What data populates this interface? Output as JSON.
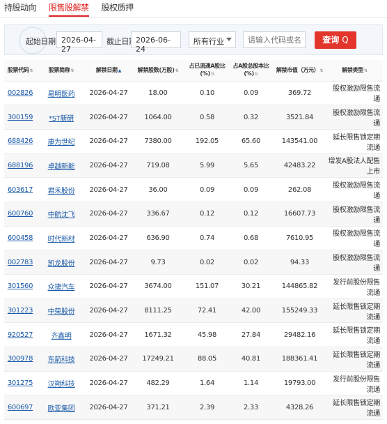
{
  "tabs": [
    "持股动向",
    "限售股解禁",
    "股权质押"
  ],
  "active_tab": 1,
  "filter": {
    "start_label": "起始日期：",
    "start_value": "2026-04-27",
    "end_label": "截止日期：",
    "end_value": "2026-06-24",
    "industry": "所有行业",
    "search_placeholder": "请输入代码或名称",
    "query_label": "查询",
    "query_icon": "Q"
  },
  "table": {
    "headers": [
      "股票代码",
      "股票简称",
      "解禁日期",
      "解禁股数(万股)",
      "占已流通A股比(%)",
      "占A股总股本比(%)",
      "解禁市值（万元）",
      "解禁类型"
    ],
    "rows": [
      [
        "002826",
        "易明医药",
        "2026-04-27",
        "18.00",
        "0.10",
        "0.09",
        "369.72",
        "股权激励限售流通"
      ],
      [
        "300159",
        "*ST新研",
        "2026-04-27",
        "1064.00",
        "0.58",
        "0.32",
        "3521.84",
        "股权激励限售流通"
      ],
      [
        "688426",
        "康为世纪",
        "2026-04-27",
        "7380.00",
        "192.05",
        "65.60",
        "143541.00",
        "延长限售锁定期流通"
      ],
      [
        "688196",
        "卓越新能",
        "2026-04-27",
        "719.08",
        "5.99",
        "5.65",
        "42483.22",
        "增发A股法人配售上市"
      ],
      [
        "603617",
        "君禾股份",
        "2026-04-27",
        "36.00",
        "0.09",
        "0.09",
        "262.08",
        "股权激励限售流通"
      ],
      [
        "600760",
        "中航沈飞",
        "2026-04-27",
        "336.67",
        "0.12",
        "0.12",
        "16607.73",
        "股权激励限售流通"
      ],
      [
        "600458",
        "时代新材",
        "2026-04-27",
        "636.90",
        "0.74",
        "0.68",
        "7610.95",
        "股权激励限售流通"
      ],
      [
        "002783",
        "凯龙股份",
        "2026-04-27",
        "9.73",
        "0.02",
        "0.02",
        "94.33",
        "股权激励限售流通"
      ],
      [
        "301560",
        "众捷汽车",
        "2026-04-27",
        "3674.00",
        "151.07",
        "30.21",
        "144865.82",
        "发行前股份限售流通"
      ],
      [
        "301223",
        "中荣股份",
        "2026-04-27",
        "8111.25",
        "72.41",
        "42.00",
        "155249.33",
        "延长限售锁定期流通"
      ],
      [
        "920527",
        "齐鑫明",
        "2026-04-27",
        "1671.32",
        "45.98",
        "27.84",
        "29482.16",
        "延长限售锁定期流通"
      ],
      [
        "300978",
        "东箭科技",
        "2026-04-27",
        "17249.21",
        "88.05",
        "40.81",
        "188361.41",
        "延长限售锁定期流通"
      ],
      [
        "301275",
        "汉朔科技",
        "2026-04-27",
        "482.29",
        "1.64",
        "1.14",
        "19793.00",
        "发行前股份限售流通"
      ],
      [
        "600697",
        "欧亚集团",
        "2026-04-27",
        "371.21",
        "2.39",
        "2.33",
        "4328.26",
        "延长限售锁定期流通"
      ]
    ]
  }
}
